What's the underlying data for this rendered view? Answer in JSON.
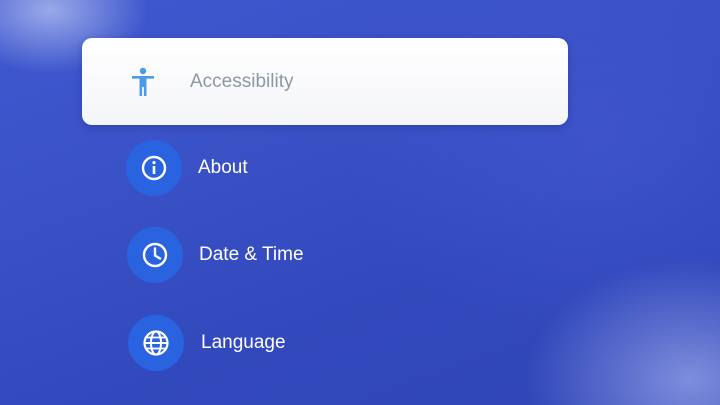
{
  "colors": {
    "background": "#3a51c6",
    "icon_circle": "#2a63e0",
    "selected_card": "#ffffff",
    "selected_label": "#8f96a6",
    "selected_icon": "#4d9be6",
    "label": "#ffffff"
  },
  "settings_menu": {
    "items": [
      {
        "label": "Accessibility",
        "icon": "accessibility-icon",
        "selected": true
      },
      {
        "label": "About",
        "icon": "info-icon",
        "selected": false
      },
      {
        "label": "Date & Time",
        "icon": "clock-icon",
        "selected": false
      },
      {
        "label": "Language",
        "icon": "globe-icon",
        "selected": false
      }
    ]
  }
}
